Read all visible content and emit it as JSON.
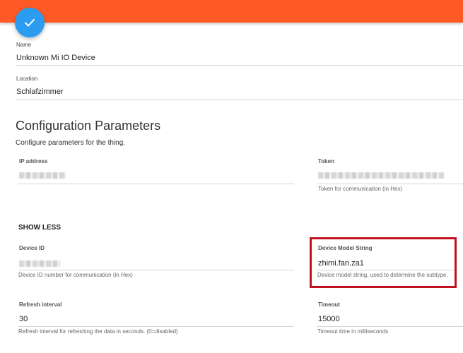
{
  "colors": {
    "topbar": "#ff5a26",
    "fab": "#2c9cf1",
    "highlight": "#c1121f"
  },
  "header": {
    "fab_icon": "check-icon"
  },
  "name_field": {
    "label": "Name",
    "value": "Unknown Mi IO Device"
  },
  "location_field": {
    "label": "Location",
    "value": "Schlafzimmer"
  },
  "config": {
    "title": "Configuration Parameters",
    "subtitle": "Configure parameters for the thing.",
    "ip_address": {
      "label": "IP address"
    },
    "token": {
      "label": "Token",
      "hint": "Token for communication (in Hex)"
    },
    "show_less_label": "SHOW LESS",
    "device_id": {
      "label": "Device ID",
      "hint": "Device ID number for communication (in Hex)"
    },
    "device_model": {
      "label": "Device Model String",
      "value": "zhimi.fan.za1",
      "hint": "Device model string, used to determine the subtype."
    },
    "refresh_interval": {
      "label": "Refresh interval",
      "value": "30",
      "hint": "Refresh interval for refreshing the data in seconds. (0=disabled)"
    },
    "timeout": {
      "label": "Timeout",
      "value": "15000",
      "hint": "Timeout time in milliseconds"
    }
  }
}
